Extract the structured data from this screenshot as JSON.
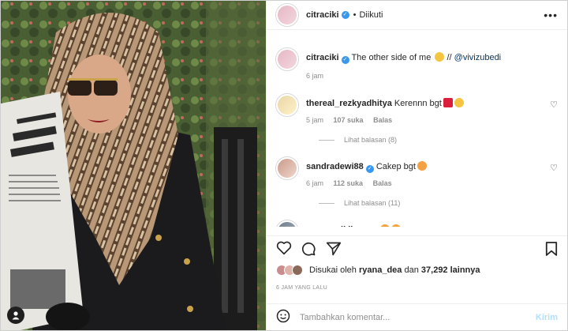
{
  "header": {
    "username": "citraciki",
    "follow_status": "Diikuti",
    "more_label": "•••"
  },
  "caption": {
    "username": "citraciki",
    "text": "The other side of me",
    "mention_sep": "//",
    "mention": "@vivizubedi",
    "time": "6 jam"
  },
  "comments": [
    {
      "username": "thereal_rezkyadhitya",
      "text": "Kerennn bgt",
      "time": "5 jam",
      "likes": "107 suka",
      "reply_label": "Balas",
      "view_replies": "Lihat balasan (8)"
    },
    {
      "username": "sandradewi88",
      "text": "Cakep bgt",
      "time": "6 jam",
      "likes": "112 suka",
      "reply_label": "Balas",
      "view_replies": "Lihat balasan (11)"
    },
    {
      "username": "susan_cikilovers",
      "text": ""
    }
  ],
  "likes": {
    "prefix": "Disukai oleh",
    "user": "ryana_dea",
    "connector": "dan",
    "count": "37,292 lainnya"
  },
  "timestamp": "6 JAM YANG LALU",
  "add_comment": {
    "placeholder": "Tambahkan komentar...",
    "post_label": "Kirim"
  },
  "colors": {
    "verified": "#3897f0",
    "link": "#00376b",
    "muted": "#8e8e8e",
    "post_disabled": "#b2dffc"
  }
}
